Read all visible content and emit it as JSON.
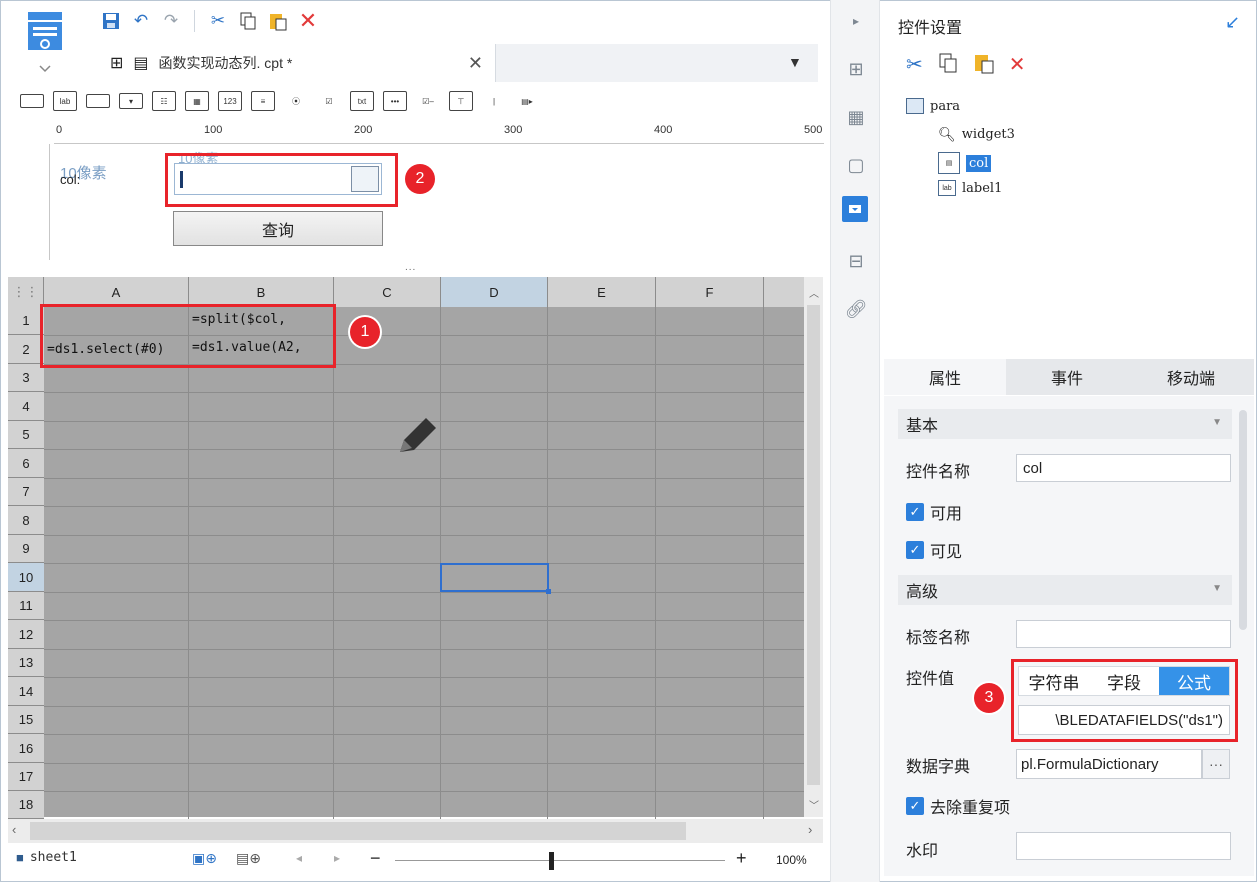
{
  "document": {
    "tab_name": "函数实现动态列. cpt *"
  },
  "toolbar2": {
    "icons": [
      "lab",
      "123",
      "txt",
      "|"
    ]
  },
  "ruler": {
    "labels": [
      "0",
      "100",
      "200",
      "300",
      "400",
      "500"
    ]
  },
  "param_pane": {
    "hint_left": "10像素",
    "hint_top": "10像素",
    "label_text": "col:",
    "query_button": "查询",
    "splitter": "..."
  },
  "sheet": {
    "columns": [
      "A",
      "B",
      "C",
      "D",
      "E",
      "F"
    ],
    "rows": [
      "1",
      "2",
      "3",
      "4",
      "5",
      "6",
      "7",
      "8",
      "9",
      "10",
      "11",
      "12",
      "13",
      "14",
      "15",
      "16",
      "17",
      "18"
    ],
    "cells": {
      "B1": "=split($col,",
      "A2": "=ds1.select(#0)",
      "B2": "=ds1.value(A2,"
    },
    "sheet_tab": "sheet1",
    "zoom": "100%"
  },
  "panel": {
    "title": "控件设置",
    "tree": [
      {
        "label": "para"
      },
      {
        "label": "widget3"
      },
      {
        "label": "col"
      },
      {
        "label": "label1"
      }
    ],
    "tabs": [
      "属性",
      "事件",
      "移动端"
    ],
    "sections": {
      "basic": "基本",
      "advanced": "高级"
    },
    "fields": {
      "name_label": "控件名称",
      "name_value": "col",
      "enabled": "可用",
      "visible": "可见",
      "tag_label": "标签名称",
      "tag_value": "",
      "value_label": "控件值",
      "value_modes": [
        "字符串",
        "字段",
        "公式"
      ],
      "formula_value": "\\BLEDATAFIELDS(\"ds1\")",
      "dict_label": "数据字典",
      "dict_value": "pl.FormulaDictionary",
      "dict_btn": "···",
      "dedupe": "去除重复项",
      "watermark_label": "水印",
      "watermark_value": ""
    }
  },
  "annotations": [
    "1",
    "2",
    "3"
  ],
  "colors": {
    "accent": "#2c7fdb",
    "annotation": "#e8232a",
    "sheet_bg": "#a5a5a5"
  }
}
